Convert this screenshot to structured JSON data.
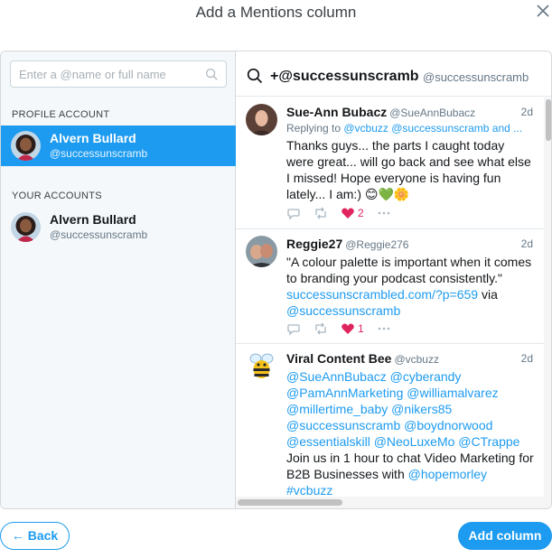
{
  "dialog": {
    "title": "Add a Mentions column"
  },
  "left": {
    "search_placeholder": "Enter a @name or full name",
    "profile_label": "PROFILE ACCOUNT",
    "profile": {
      "name": "Alvern Bullard",
      "handle": "@successunscramb"
    },
    "your_accounts_label": "YOUR ACCOUNTS",
    "accounts": [
      {
        "name": "Alvern Bullard",
        "handle": "@successunscramb"
      }
    ]
  },
  "column": {
    "query": "+@successunscramb",
    "handle": "@successunscramb"
  },
  "tweets": [
    {
      "name": "Sue-Ann Bubacz",
      "handle": "@SueAnnBubacz",
      "time": "2d",
      "reply_prefix": "Replying to ",
      "reply_to": "@vcbuzz @successunscramb and ...",
      "body": "Thanks guys... the parts I caught today were great... will go back and see what else I missed! Hope everyone is having fun lately... I am:) 😊💚🌼",
      "likes": "2"
    },
    {
      "name": "Reggie27",
      "handle": "@Reggie276",
      "time": "2d",
      "body_text": "\"A colour palette is important when it comes to branding your podcast consistently.\" ",
      "body_link": "successunscrambled.com/?p=659",
      "body_via": " via ",
      "body_mention": "@successunscramb",
      "likes": "1"
    },
    {
      "name": "Viral Content Bee",
      "handle": "@vcbuzz",
      "time": "2d",
      "mentions": "@SueAnnBubacz @cyberandy @PamAnnMarketing @williamalvarez @millertime_baby @nikers85 @successunscramb @boydnorwood @essentialskill @NeoLuxeMo @CTrappe",
      "body_text": " Join us in 1 hour to chat Video Marketing for B2B Businesses with ",
      "body_mention": "@hopemorley",
      "hashtag": "#vcbuzz"
    }
  ],
  "footer": {
    "back_label": "← Back",
    "add_label": "Add column"
  },
  "colors": {
    "accent": "#1d9bf0",
    "like": "#e0245e",
    "selected_bg": "#1d9bf0"
  }
}
